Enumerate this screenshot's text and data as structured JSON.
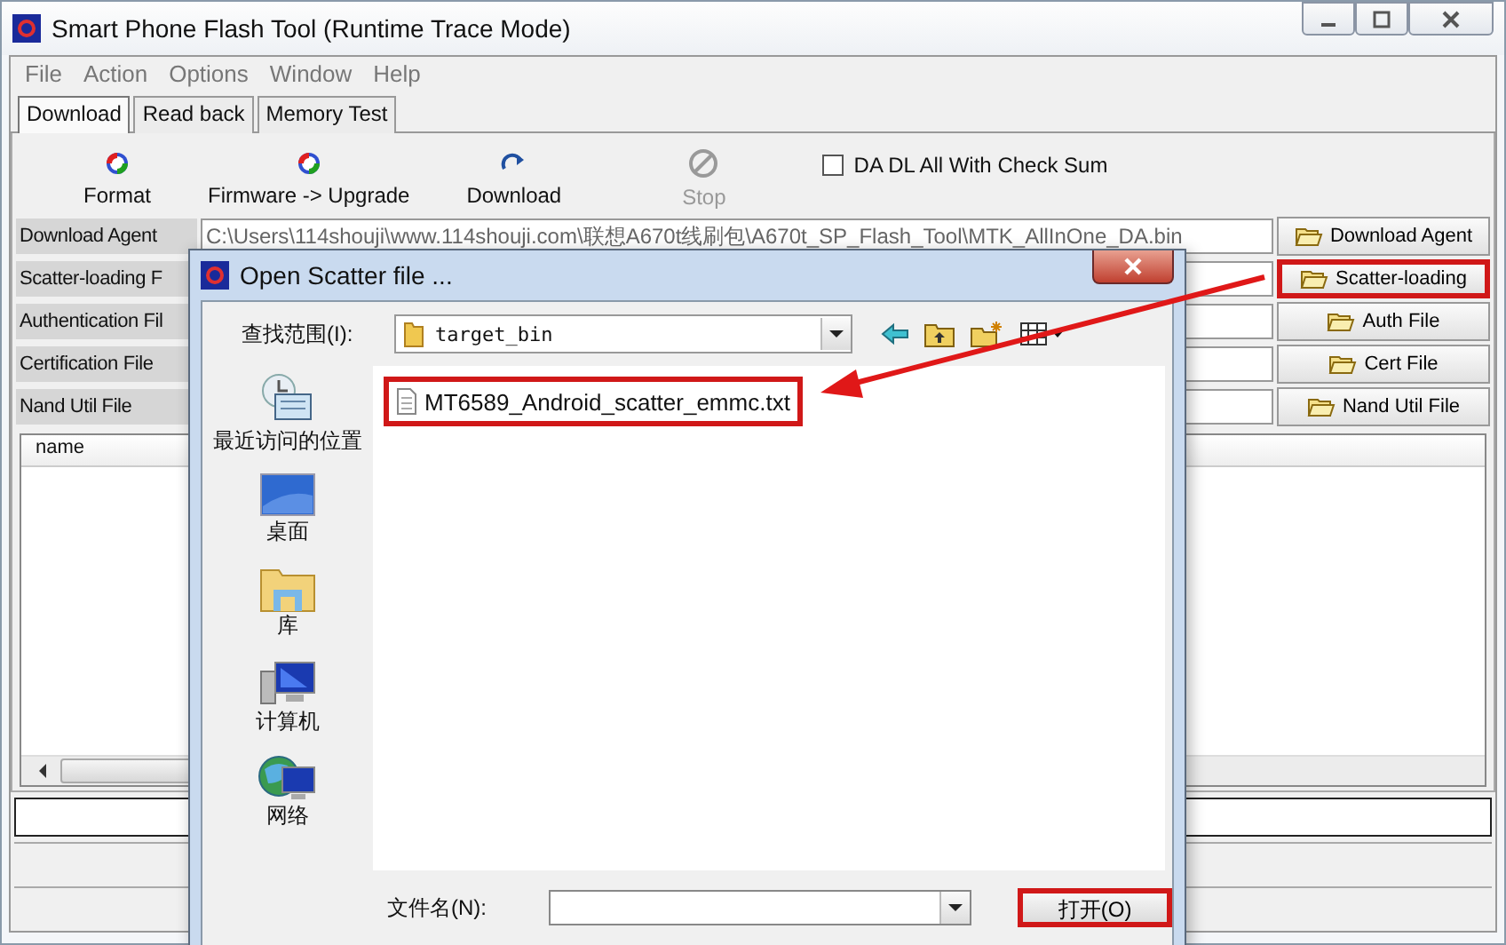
{
  "window": {
    "title": "Smart Phone Flash Tool (Runtime Trace Mode)"
  },
  "menu": [
    "File",
    "Action",
    "Options",
    "Window",
    "Help"
  ],
  "tabs": [
    {
      "label": "Download",
      "selected": true
    },
    {
      "label": "Read back",
      "selected": false
    },
    {
      "label": "Memory Test",
      "selected": false
    }
  ],
  "toolbar": [
    {
      "label": "Format",
      "disabled": false
    },
    {
      "label": "Firmware -> Upgrade",
      "disabled": false
    },
    {
      "label": "Download",
      "disabled": false
    },
    {
      "label": "Stop",
      "disabled": true
    }
  ],
  "checksum_option": {
    "label": "DA DL All With Check Sum",
    "checked": false
  },
  "file_rows": [
    {
      "label": "Download Agent",
      "value": "C:\\Users\\114shouji\\www.114shouji.com\\联想A670t线刷包\\A670t_SP_Flash_Tool\\MTK_AllInOne_DA.bin",
      "button": "Download Agent",
      "highlighted": false
    },
    {
      "label": "Scatter-loading F",
      "button": "Scatter-loading",
      "highlighted": true
    },
    {
      "label": "Authentication Fil",
      "button": "Auth File",
      "highlighted": false
    },
    {
      "label": "Certification File",
      "button": "Cert File",
      "highlighted": false
    },
    {
      "label": "Nand Util File",
      "button": "Nand Util File",
      "highlighted": false
    }
  ],
  "list": {
    "columns": [
      "name"
    ]
  },
  "dialog": {
    "title": "Open Scatter file ...",
    "look_in_label": "查找范围(I):",
    "look_in_value": "target_bin",
    "places": [
      {
        "label": "最近访问的位置"
      },
      {
        "label": "桌面"
      },
      {
        "label": "库"
      },
      {
        "label": "计算机"
      },
      {
        "label": "网络"
      }
    ],
    "files": [
      {
        "name": "MT6589_Android_scatter_emmc.txt",
        "highlighted": true
      }
    ],
    "filename_label": "文件名(N):",
    "open_button": {
      "label": "打开(O)",
      "highlighted": true
    }
  }
}
